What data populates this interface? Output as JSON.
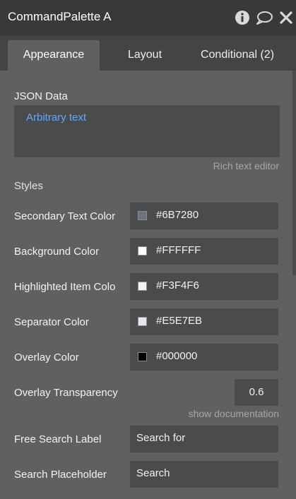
{
  "window": {
    "title": "CommandPalette A",
    "icons": [
      "info-icon",
      "comment-icon",
      "close-icon"
    ]
  },
  "tabs": [
    {
      "label": "Appearance",
      "active": true
    },
    {
      "label": "Layout",
      "active": false
    },
    {
      "label": "Conditional (2)",
      "active": false
    }
  ],
  "json_data": {
    "label": "JSON Data",
    "value": "Arbitrary text",
    "hint": "Rich text editor"
  },
  "styles": {
    "heading": "Styles",
    "colors": [
      {
        "label": "Secondary Text Color",
        "value": "#6B7280",
        "swatch": "#6B7280"
      },
      {
        "label": "Background Color",
        "value": "#FFFFFF",
        "swatch": "#FFFFFF"
      },
      {
        "label": "Highlighted Item Colo",
        "value": "#F3F4F6",
        "swatch": "#F3F4F6"
      },
      {
        "label": "Separator Color",
        "value": "#E5E7EB",
        "swatch": "#E5E7EB"
      },
      {
        "label": "Overlay Color",
        "value": "#000000",
        "swatch": "#000000"
      }
    ],
    "overlay_transparency": {
      "label": "Overlay Transparency",
      "value": "0.6"
    },
    "doc_link": "show documentation",
    "free_search_label": {
      "label": "Free Search Label",
      "value": "Search for"
    },
    "search_placeholder": {
      "label": "Search Placeholder",
      "value": "Search"
    }
  },
  "theme": {
    "accent": "#62A8FF",
    "panel_bg": "#5F6062",
    "field_bg": "#4A4B4D",
    "titlebar_bg": "#37393B"
  }
}
